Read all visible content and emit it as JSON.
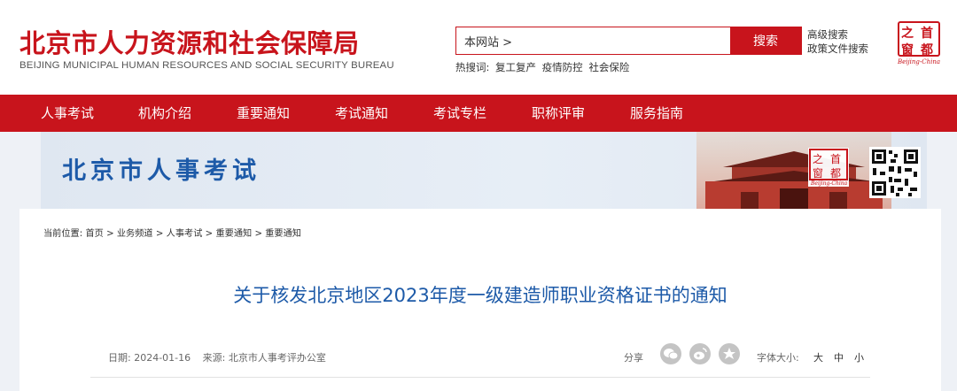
{
  "header": {
    "title": "北京市人力资源和社会保障局",
    "subtitle": "BEIJING MUNICIPAL HUMAN RESOURCES AND SOCIAL SECURITY BUREAU",
    "search": {
      "value": "本网站 >",
      "button": "搜索"
    },
    "advanced_search": "高级搜索",
    "policy_search": "政策文件搜索",
    "hot_label": "热搜词:",
    "hot_words": [
      "复工复产",
      "疫情防控",
      "社会保险"
    ],
    "seal_chars": [
      "之",
      "首",
      "窗",
      "都"
    ],
    "seal_caption": "Beijing-China"
  },
  "nav": {
    "items": [
      "人事考试",
      "机构介绍",
      "重要通知",
      "考试通知",
      "考试专栏",
      "职称评审",
      "服务指南"
    ]
  },
  "banner": {
    "title": "北京市人事考试",
    "seal_chars": [
      "之",
      "首",
      "窗",
      "都"
    ],
    "seal_caption": "Beijing-China"
  },
  "breadcrumb": {
    "label": "当前位置:",
    "items": [
      "首页",
      "业务频道",
      "人事考试",
      "重要通知",
      "重要通知"
    ],
    "sep": ">"
  },
  "article": {
    "title": "关于核发北京地区2023年度一级建造师职业资格证书的通知",
    "date_label": "日期:",
    "date": "2024-01-16",
    "source_label": "来源:",
    "source": "北京市人事考评办公室",
    "share_label": "分享",
    "font_size_label": "字体大小:",
    "font_sizes": [
      "大",
      "中",
      "小"
    ]
  },
  "colors": {
    "brand_red": "#c8141c",
    "title_blue": "#1d5aa8"
  }
}
